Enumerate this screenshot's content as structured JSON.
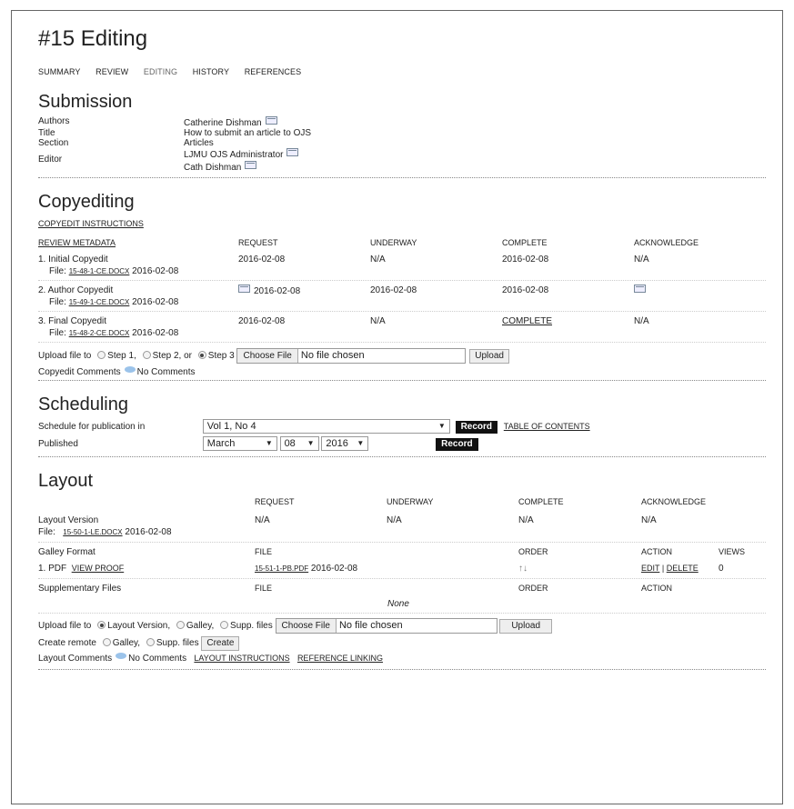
{
  "page": {
    "title": "#15 Editing",
    "tabs": [
      "SUMMARY",
      "REVIEW",
      "EDITING",
      "HISTORY",
      "REFERENCES"
    ]
  },
  "submission": {
    "heading": "Submission",
    "authors_label": "Authors",
    "authors_value": "Catherine Dishman",
    "title_label": "Title",
    "title_value": "How to submit an article to OJS",
    "section_label": "Section",
    "section_value": "Articles",
    "editor_label": "Editor",
    "editor_values": [
      "LJMU OJS Administrator",
      "Cath Dishman"
    ]
  },
  "copyediting": {
    "heading": "Copyediting",
    "instructions_link": "COPYEDIT INSTRUCTIONS",
    "review_metadata_link": "REVIEW METADATA",
    "columns": [
      "REQUEST",
      "UNDERWAY",
      "COMPLETE",
      "ACKNOWLEDGE"
    ],
    "rows": [
      {
        "label": "1. Initial Copyedit",
        "file_label": "File:",
        "file": "15-48-1-CE.DOCX",
        "file_date": "2016-02-08",
        "request": "2016-02-08",
        "underway": "N/A",
        "complete": "2016-02-08",
        "acknowledge": "N/A"
      },
      {
        "label": "2. Author Copyedit",
        "file_label": "File:",
        "file": "15-49-1-CE.DOCX",
        "file_date": "2016-02-08",
        "request": "2016-02-08",
        "underway": "2016-02-08",
        "complete": "2016-02-08",
        "acknowledge": ""
      },
      {
        "label": "3. Final Copyedit",
        "file_label": "File:",
        "file": "15-48-2-CE.DOCX",
        "file_date": "2016-02-08",
        "request": "2016-02-08",
        "underway": "N/A",
        "complete": "COMPLETE",
        "acknowledge": "N/A"
      }
    ],
    "upload_label": "Upload file to",
    "step1": "Step 1,",
    "step2": "Step 2, or",
    "step3": "Step 3",
    "choose_file": "Choose File",
    "no_file": "No file chosen",
    "upload_button": "Upload",
    "comments_label": "Copyedit Comments",
    "comments_value": "No Comments"
  },
  "scheduling": {
    "heading": "Scheduling",
    "schedule_label": "Schedule for publication in",
    "issue_value": "Vol 1, No 4",
    "record_button": "Record",
    "toc_link": "TABLE OF CONTENTS",
    "published_label": "Published",
    "month": "March",
    "day": "08",
    "year": "2016"
  },
  "layout": {
    "heading": "Layout",
    "columns": [
      "REQUEST",
      "UNDERWAY",
      "COMPLETE",
      "ACKNOWLEDGE"
    ],
    "version_label": "Layout Version",
    "version_request": "N/A",
    "version_underway": "N/A",
    "version_complete": "N/A",
    "version_ack": "N/A",
    "file_label": "File:",
    "file": "15-50-1-LE.DOCX",
    "file_date": "2016-02-08",
    "galley_heading": "Galley Format",
    "galley_file_col": "FILE",
    "galley_order_col": "ORDER",
    "galley_action_col": "ACTION",
    "galley_views_col": "VIEWS",
    "galley_row_label": "1. PDF",
    "galley_view_proof": "VIEW PROOF",
    "galley_file": "15-51-1-PB.PDF",
    "galley_date": "2016-02-08",
    "galley_order": "↑↓",
    "galley_edit": "EDIT",
    "galley_sep": "|",
    "galley_delete": "DELETE",
    "galley_views": "0",
    "supp_heading": "Supplementary Files",
    "supp_file_col": "FILE",
    "supp_order_col": "ORDER",
    "supp_action_col": "ACTION",
    "supp_none": "None",
    "upload_label": "Upload file to",
    "opt_layout": "Layout Version,",
    "opt_galley": "Galley,",
    "opt_supp": "Supp. files",
    "choose_file": "Choose File",
    "no_file": "No file chosen",
    "upload_button": "Upload",
    "remote_label": "Create remote",
    "remote_galley": "Galley,",
    "remote_supp": "Supp. files",
    "create_button": "Create",
    "comments_label": "Layout Comments",
    "comments_value": "No Comments",
    "instructions_link": "LAYOUT INSTRUCTIONS",
    "reference_link": "REFERENCE LINKING"
  }
}
